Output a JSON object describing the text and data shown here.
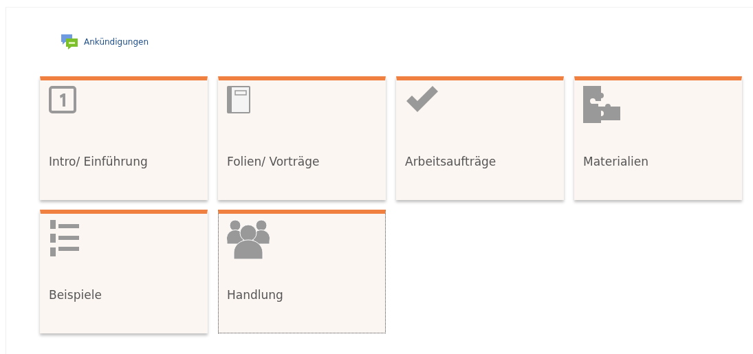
{
  "link": {
    "label": "Ankündigungen"
  },
  "tiles": [
    {
      "label": "Intro/ Einführung",
      "kind": "number",
      "focused": false
    },
    {
      "label": "Folien/ Vorträge",
      "kind": "notebook",
      "focused": false
    },
    {
      "label": "Arbeitsaufträge",
      "kind": "check",
      "focused": false
    },
    {
      "label": "Materialien",
      "kind": "puzzle",
      "focused": false
    },
    {
      "label": "Beispiele",
      "kind": "list",
      "focused": false
    },
    {
      "label": "Handlung",
      "kind": "group",
      "focused": true
    }
  ]
}
